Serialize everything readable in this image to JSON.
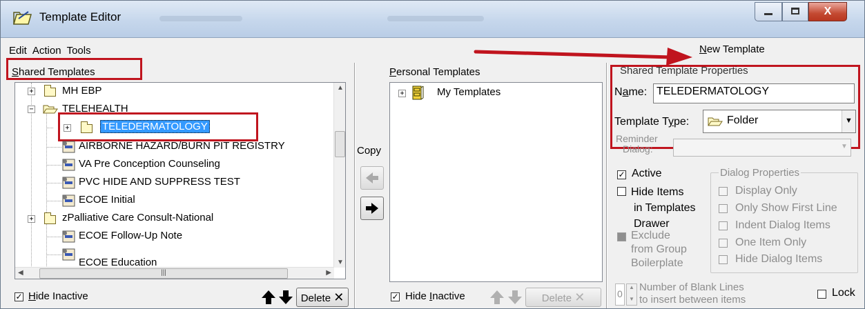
{
  "window": {
    "title": "Template Editor",
    "title_blur_1": "",
    "title_blur_2": "",
    "controls": {
      "minimize": "—",
      "maximize": "▢",
      "close": "X"
    }
  },
  "menu": {
    "edit": "Edit",
    "action": "Action",
    "tools": "Tools"
  },
  "toolbar": {
    "new_template_prefix": "",
    "new_template_underline": "N",
    "new_template_rest": "ew Template"
  },
  "shared": {
    "header_underline": "S",
    "header_rest": "hared Templates",
    "tree": [
      {
        "label": "MH EBP",
        "kind": "folder",
        "expander": "+"
      },
      {
        "label": "TELEHEALTH",
        "kind": "folder-open",
        "expander": "−"
      },
      {
        "label": "TELEDERMATOLOGY",
        "kind": "folder",
        "expander": "+",
        "selected": true
      },
      {
        "label": "AIRBORNE HAZARD/BURN PIT REGISTRY",
        "kind": "template"
      },
      {
        "label": "VA Pre Conception Counseling",
        "kind": "template"
      },
      {
        "label": "PVC HIDE AND SUPPRESS TEST",
        "kind": "template"
      },
      {
        "label": "ECOE Initial",
        "kind": "template"
      },
      {
        "label": "zPalliative Care Consult-National",
        "kind": "folder",
        "expander": "+"
      },
      {
        "label": "ECOE Follow-Up Note",
        "kind": "template"
      },
      {
        "label": "ECOE Education",
        "kind": "template"
      }
    ],
    "hide_inactive_underline": "H",
    "hide_inactive_rest": "ide Inactive",
    "hide_inactive_checked": "✓",
    "delete_label": "Delete"
  },
  "copy": {
    "label": "Copy"
  },
  "personal": {
    "header_underline": "P",
    "header_rest": "ersonal Templates",
    "tree": [
      {
        "label": "My Templates",
        "expander": "+"
      }
    ],
    "hide_inactive_pre": "Hide ",
    "hide_inactive_underline": "I",
    "hide_inactive_rest": "nactive",
    "hide_inactive_checked": "✓",
    "delete_label": "Delete"
  },
  "properties": {
    "header": "Shared Template Properties",
    "name_label_pre": "N",
    "name_label_underline": "a",
    "name_label_rest": "me:",
    "name_value": "TELEDERMATOLOGY",
    "type_label_pre": "Template T",
    "type_label_underline": "y",
    "type_label_rest": "pe:",
    "type_value": "Folder",
    "reminder_label_line1": "Reminder",
    "reminder_label_line2": "Dialog:",
    "active_label": "Active",
    "active_checked": "✓",
    "hide_items_line1": "Hide Items",
    "hide_items_line2": "in Templates",
    "hide_items_line3": "Drawer",
    "exclude_line1": "Exclude",
    "exclude_line2": "from Group",
    "exclude_line3": "Boilerplate",
    "dialog_properties_title": "Dialog Properties",
    "dialog_options": [
      "Display Only",
      "Only Show First Line",
      "Indent Dialog Items",
      "One Item Only",
      "Hide Dialog Items"
    ],
    "blank_lines_value": "0",
    "blank_lines_line1": "Number of Blank Lines",
    "blank_lines_line2": "to insert between items",
    "lock_label": "Lock"
  },
  "colors": {
    "annotation_red": "#c0141e",
    "selection_blue": "#3399ff"
  }
}
